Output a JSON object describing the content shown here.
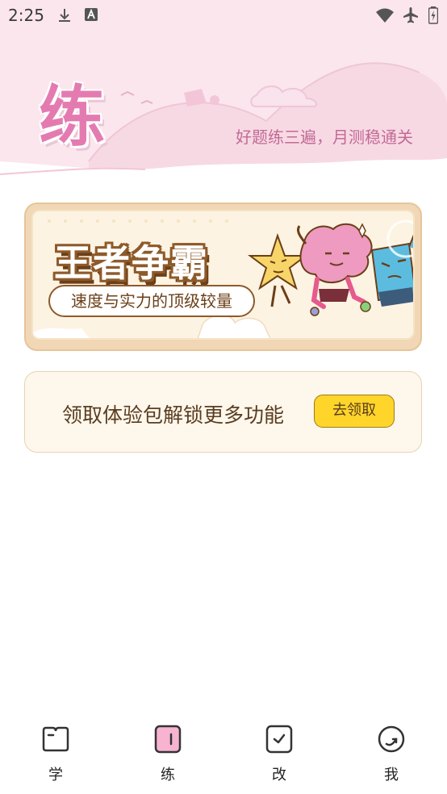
{
  "status_bar": {
    "time": "2:25"
  },
  "header": {
    "big_title": "练",
    "slogan": "好题练三遍，月测稳通关"
  },
  "banner": {
    "title": "王者争霸",
    "subtitle": "速度与实力的顶级较量"
  },
  "promo": {
    "text": "领取体验包解锁更多功能",
    "button_label": "去领取"
  },
  "bottom_nav": {
    "items": [
      {
        "label": "学",
        "icon": "book-icon"
      },
      {
        "label": "练",
        "icon": "practice-icon",
        "active": true
      },
      {
        "label": "改",
        "icon": "check-icon"
      },
      {
        "label": "我",
        "icon": "profile-icon"
      }
    ]
  },
  "colors": {
    "header_bg": "#fbe6ee",
    "accent_pink": "#e47bb0",
    "button_yellow": "#ffd52a",
    "banner_brown": "#8e5a2a"
  }
}
